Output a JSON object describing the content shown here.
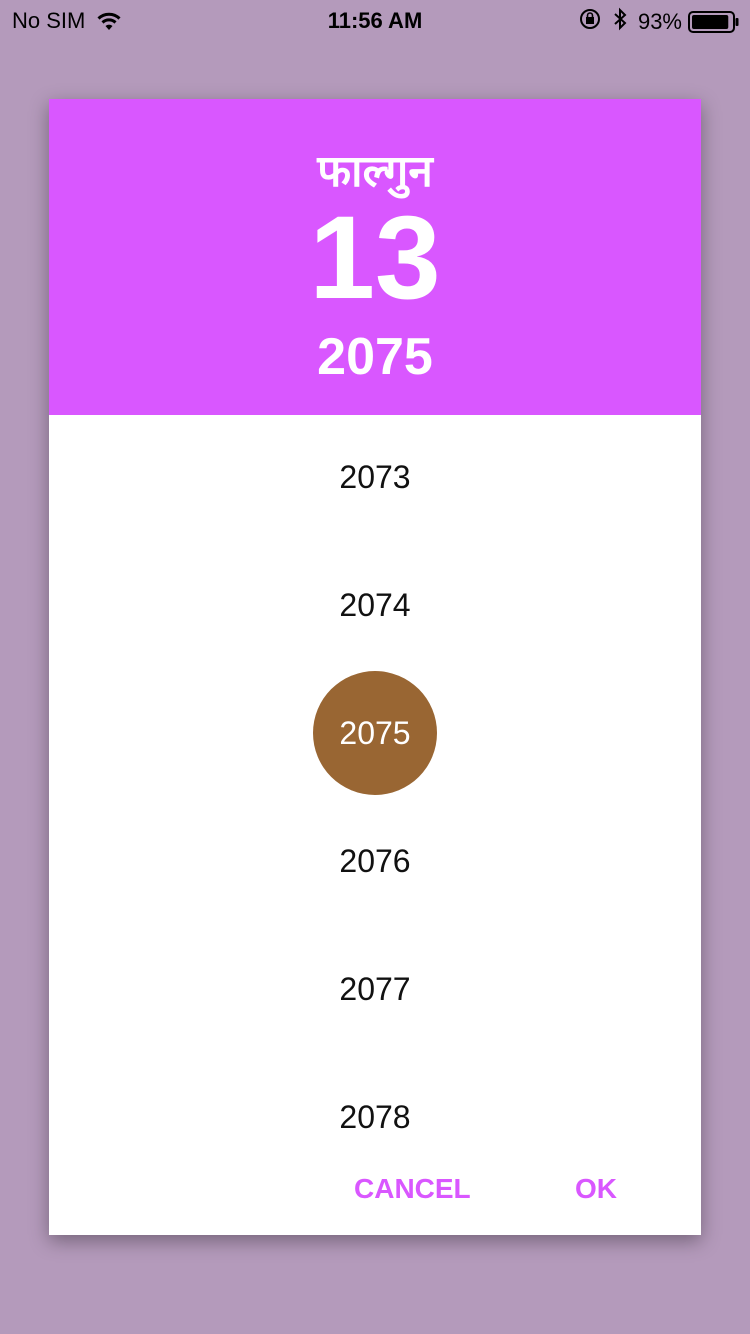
{
  "status_bar": {
    "carrier": "No SIM",
    "time": "11:56 AM",
    "battery_percent": "93%",
    "battery_level": 0.93,
    "icons": [
      "wifi-icon",
      "lock-rotation-icon",
      "bluetooth-icon",
      "battery-icon"
    ]
  },
  "colors": {
    "accent": "#d957ff",
    "backdrop": "#b49abb",
    "selected_circle": "#996633"
  },
  "dialog": {
    "header": {
      "month": "फाल्गुन",
      "day": "13",
      "year": "2075"
    },
    "years": [
      "2073",
      "2074",
      "2075",
      "2076",
      "2077",
      "2078"
    ],
    "selected_year": "2075",
    "cancel_label": "CANCEL",
    "ok_label": "OK"
  }
}
